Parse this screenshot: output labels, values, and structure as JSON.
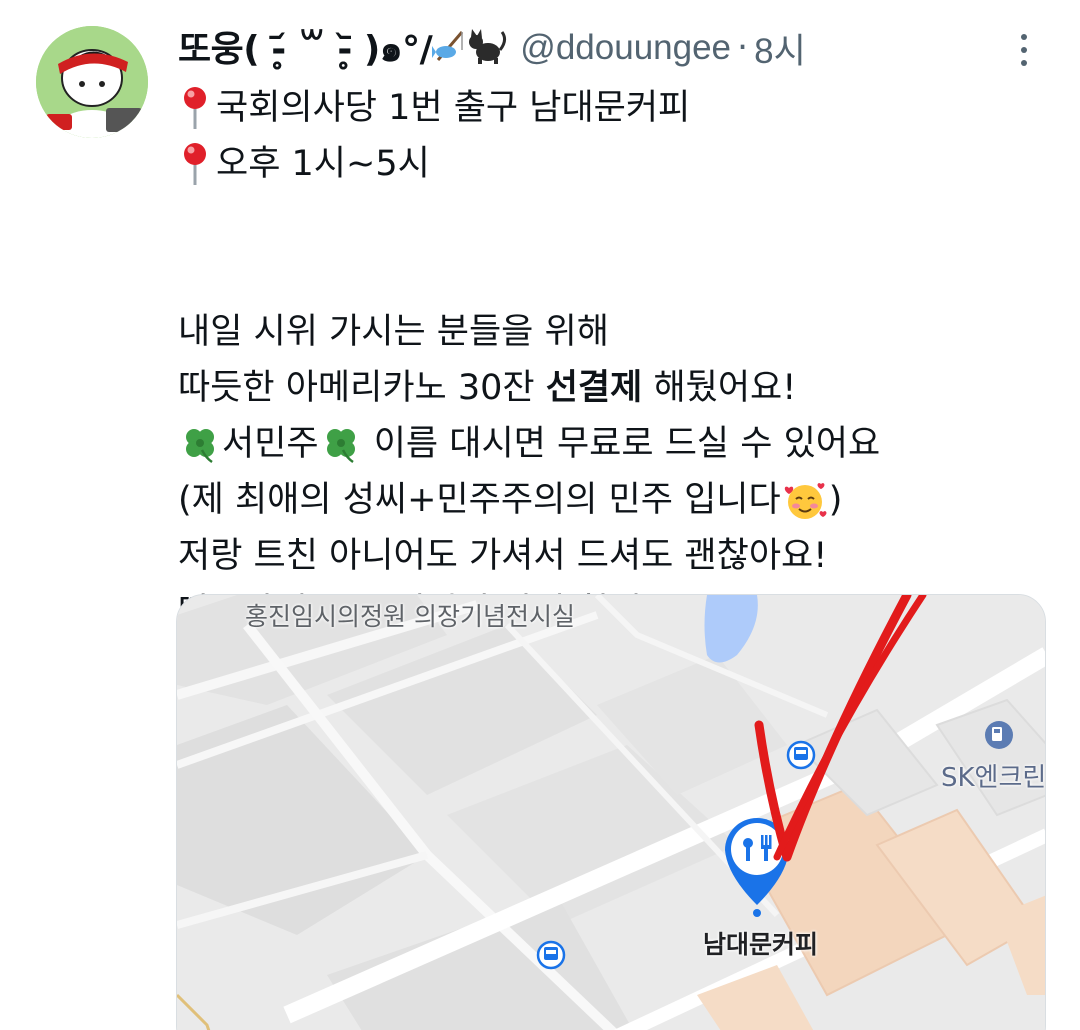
{
  "author": {
    "display_name": "또웅( -̥̥᷄ ꒳ -̥̥᷅ )",
    "display_name_symbols": "๑°/",
    "display_name_emoji": [
      "fishing-pole-emoji",
      "black-cat-emoji"
    ],
    "handle": "@ddouungee",
    "separator": "·",
    "time": "8시",
    "avatar_icon": "avatar-icon"
  },
  "tweet": {
    "pin_line_1": "국회의사당 1번 출구 남대문커피",
    "pin_line_2": "오후 1시~5시",
    "line_3": "내일 시위 가시는 분들을 위해",
    "line_4_pre": "따듯한 아메리카노 30잔 ",
    "line_4_bold": "선결제",
    "line_4_post": " 해뒀어요!",
    "line_5_name": "서민주",
    "line_5_post": " 이름 대시면 무료로 드실 수 있어요",
    "line_6": "(제 최애의 성씨+민주주의의 민주 입니다",
    "line_6_end": ")",
    "line_7": "저랑 트친 아니어도 가셔서 드셔도 괜찮아요!",
    "line_8": "따듯하게 몸 녹이면서 같이 힘내요"
  },
  "map": {
    "label_museum": "홍진임시의정원 의장기념전시실",
    "label_station": "SK엔크린",
    "label_place": "남대문커피",
    "colors": {
      "background": "#eaeaea",
      "road": "#ffffff",
      "water": "#aecbfa",
      "building": "#f6dcc4",
      "pin": "#1a73e8",
      "marker_red": "#e21b1b"
    }
  }
}
